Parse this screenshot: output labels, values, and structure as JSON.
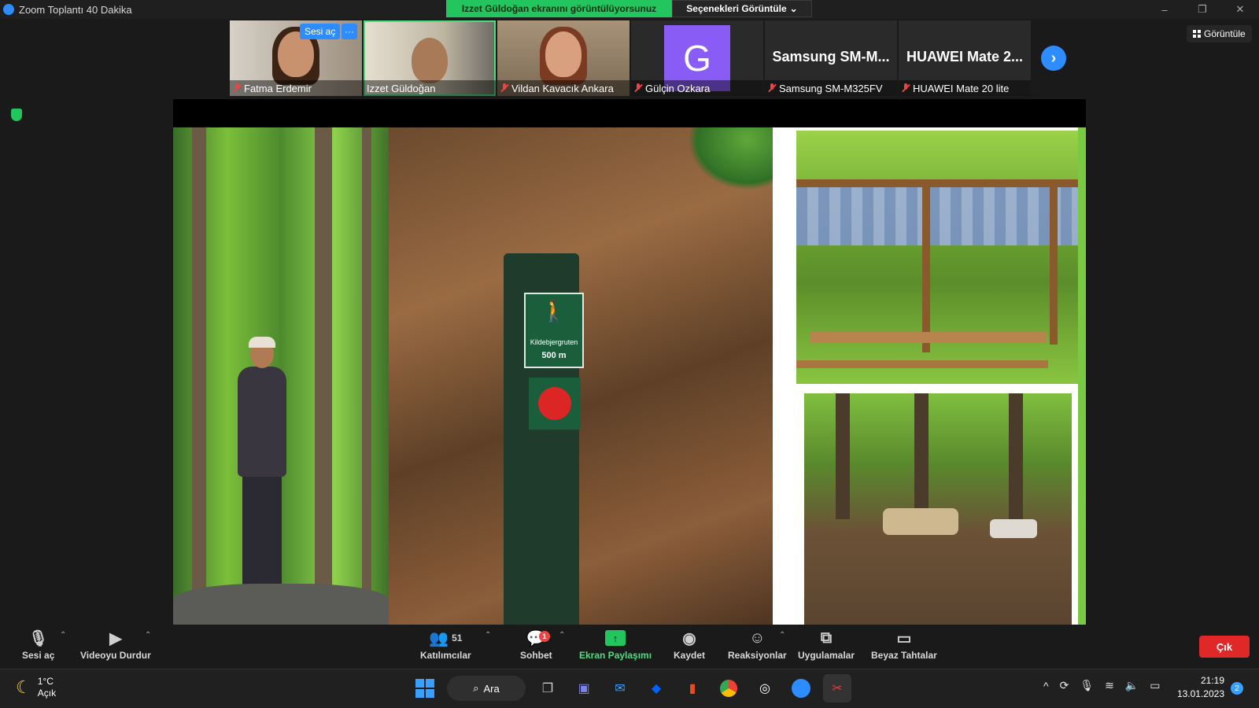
{
  "window": {
    "title": "Zoom Toplantı 40 Dakika",
    "controls": [
      "–",
      "❐",
      "✕"
    ]
  },
  "share_banner": "Izzet Güldoğan ekranını görüntülüyorsunuz",
  "view_options": "Seçenekleri Görüntüle",
  "view_button": "Görüntüle",
  "unmute_hover": "Sesi aç",
  "more_hover": "···",
  "participants": [
    {
      "name": "Fatma Erdemir",
      "muted": true,
      "type": "video"
    },
    {
      "name": "Izzet Güldoğan",
      "muted": false,
      "type": "video"
    },
    {
      "name": "Vildan Kavacık Ankara",
      "muted": true,
      "type": "video"
    },
    {
      "name": "Gülçin Ozkara",
      "muted": true,
      "type": "avatar",
      "initial": "G"
    },
    {
      "name": "Samsung SM-M325FV",
      "muted": true,
      "type": "device",
      "title": "Samsung SM-M..."
    },
    {
      "name": "HUAWEI Mate 20 lite",
      "muted": true,
      "type": "device",
      "title": "HUAWEI Mate 2..."
    }
  ],
  "slide": {
    "sign_text": "Kildebjergruten",
    "sign_distance": "500 m"
  },
  "toolbar": {
    "unmute": "Sesi aç",
    "stop_video": "Videoyu Durdur",
    "participants": "Katılımcılar",
    "participants_count": "51",
    "chat": "Sohbet",
    "chat_badge": "1",
    "share": "Ekran Paylaşımı",
    "record": "Kaydet",
    "reactions": "Reaksiyonlar",
    "apps": "Uygulamalar",
    "whiteboards": "Beyaz Tahtalar",
    "leave": "Çık"
  },
  "taskbar": {
    "temperature": "1°C",
    "condition": "Açık",
    "search": "Ara",
    "time": "21:19",
    "date": "13.01.2023",
    "notifications": "2"
  },
  "colors": {
    "accent_blue": "#2d8cff",
    "share_green": "#22c55e",
    "leave_red": "#e02828",
    "avatar_purple": "#8a5cf6"
  }
}
